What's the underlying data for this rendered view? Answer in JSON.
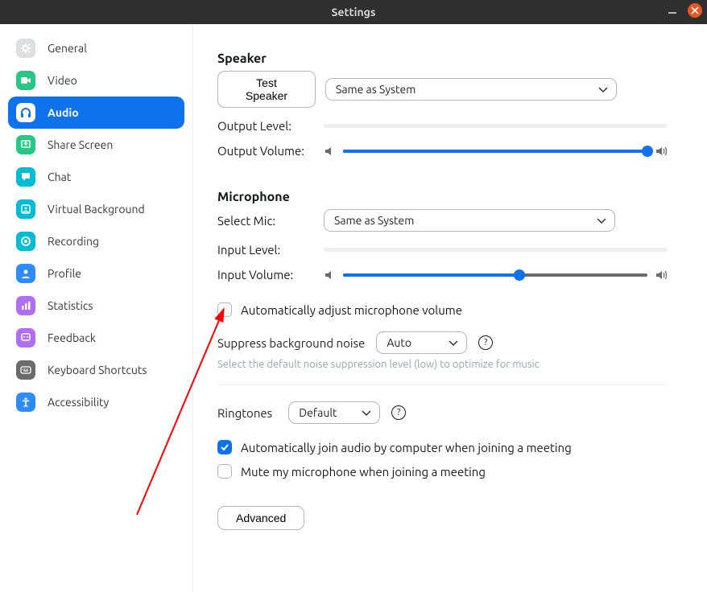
{
  "titlebar": {
    "title": "Settings"
  },
  "sidebar": {
    "items": [
      {
        "label": "General",
        "color": "#dedfe0",
        "icon": "gear"
      },
      {
        "label": "Video",
        "color": "#27c885",
        "icon": "video"
      },
      {
        "label": "Audio",
        "color": "#ffffff",
        "icon": "headphones",
        "active": true
      },
      {
        "label": "Share Screen",
        "color": "#27c885",
        "icon": "share"
      },
      {
        "label": "Chat",
        "color": "#00bcd4",
        "icon": "chat"
      },
      {
        "label": "Virtual Background",
        "color": "#00bcd4",
        "icon": "vb"
      },
      {
        "label": "Recording",
        "color": "#00bcd4",
        "icon": "record"
      },
      {
        "label": "Profile",
        "color": "#2f8cff",
        "icon": "profile"
      },
      {
        "label": "Statistics",
        "color": "#b06ff2",
        "icon": "stats"
      },
      {
        "label": "Feedback",
        "color": "#b06ff2",
        "icon": "feedback"
      },
      {
        "label": "Keyboard Shortcuts",
        "color": "#6b6b6b",
        "icon": "keyboard"
      },
      {
        "label": "Accessibility",
        "color": "#2f8cff",
        "icon": "accessibility"
      }
    ]
  },
  "audio": {
    "speaker": {
      "title": "Speaker",
      "test_button": "Test Speaker",
      "device": "Same as System",
      "output_level_label": "Output Level:",
      "output_volume_label": "Output Volume:",
      "output_volume_pct": 100
    },
    "microphone": {
      "title": "Microphone",
      "select_label": "Select Mic:",
      "device": "Same as System",
      "input_level_label": "Input Level:",
      "input_volume_label": "Input Volume:",
      "input_volume_pct": 58,
      "auto_adjust_label": "Automatically adjust microphone volume",
      "auto_adjust_checked": false,
      "suppress_label": "Suppress background noise",
      "suppress_value": "Auto",
      "suppress_help": "Select the default noise suppression level (low) to optimize for music"
    },
    "ringtones": {
      "label": "Ringtones",
      "value": "Default"
    },
    "auto_join": {
      "label": "Automatically join audio by computer when joining a meeting",
      "checked": true
    },
    "mute_on_join": {
      "label": "Mute my microphone when joining a meeting",
      "checked": false
    },
    "advanced_button": "Advanced"
  }
}
